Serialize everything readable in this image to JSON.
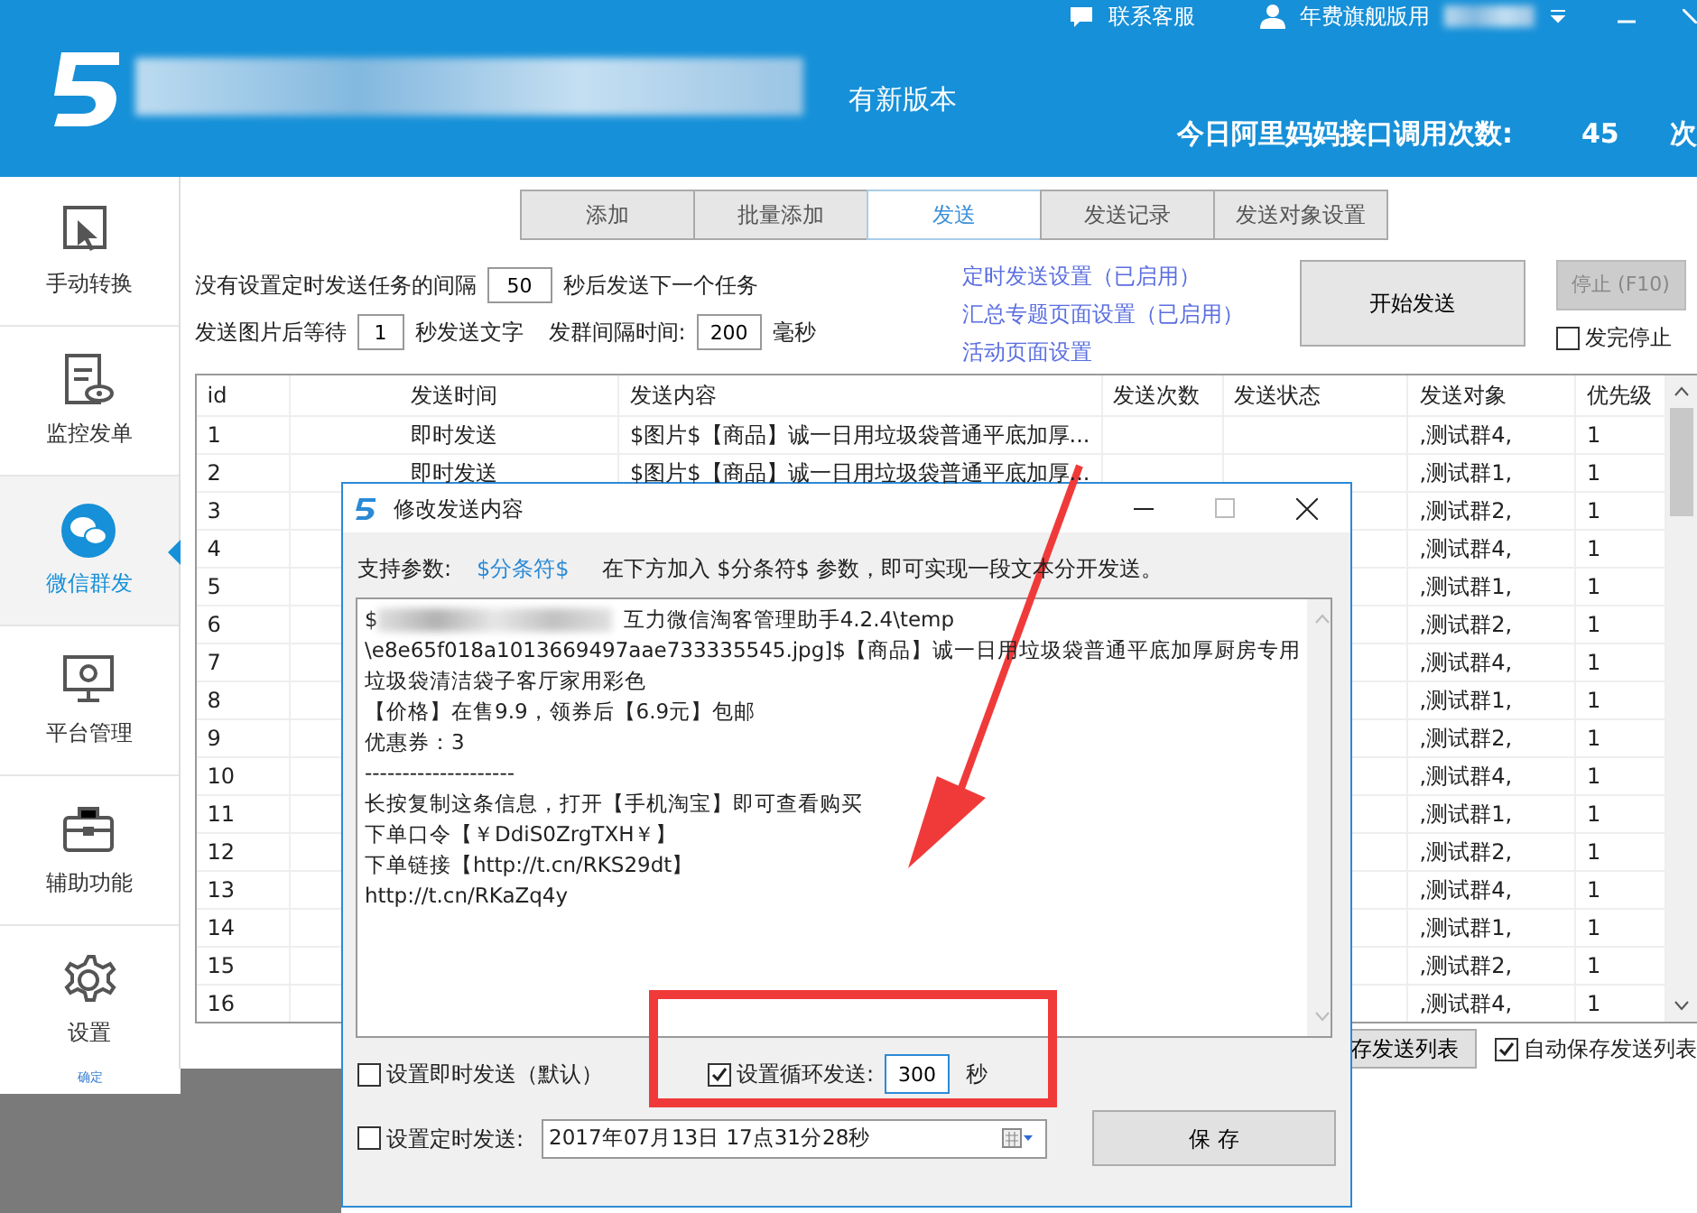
{
  "header": {
    "update_notice": "有新版本",
    "api_label": "今日阿里妈妈接口调用次数:",
    "api_count": "45",
    "api_suffix": "次",
    "top_links": [
      "联系客服",
      "年费旗舰版用"
    ]
  },
  "sidebar": {
    "items": [
      {
        "label": "手动转换",
        "selected": false
      },
      {
        "label": "监控发单",
        "selected": false
      },
      {
        "label": "微信群发",
        "selected": true
      },
      {
        "label": "平台管理",
        "selected": false
      },
      {
        "label": "辅助功能",
        "selected": false
      },
      {
        "label": "设置",
        "selected": false
      }
    ]
  },
  "tabs": [
    {
      "label": "添加",
      "selected": false
    },
    {
      "label": "批量添加",
      "selected": false
    },
    {
      "label": "发送",
      "selected": true
    },
    {
      "label": "发送记录",
      "selected": false
    },
    {
      "label": "发送对象设置",
      "selected": false
    }
  ],
  "settings": {
    "interval_prefix": "没有设置定时发送任务的间隔",
    "interval_value": "50",
    "interval_suffix": "秒后发送下一个任务",
    "wait_prefix": "发送图片后等待",
    "wait_value": "1",
    "wait_suffix": "秒发送文字",
    "group_label": "发群间隔时间:",
    "group_value": "200",
    "group_suffix": "毫秒",
    "links": [
      "定时发送设置（已启用）",
      "汇总专题页面设置（已启用）",
      "活动页面设置"
    ],
    "start_button": "开始发送",
    "stop_button": {
      "label": "停止 (F10)",
      "disabled": true
    },
    "stop_after": {
      "label": "发完停止",
      "checked": false
    }
  },
  "table": {
    "columns": [
      "id",
      "发送时间",
      "发送内容",
      "发送次数",
      "发送状态",
      "发送对象",
      "优先级"
    ],
    "rows": [
      {
        "id": "1",
        "time": "即时发送",
        "content": "$图片$【商品】诚一日用垃圾袋普通平底加厚...",
        "target": ",测试群4,",
        "priority": "1"
      },
      {
        "id": "2",
        "time": "即时发送",
        "content": "$图片$【商品】诚一日用垃圾袋普通平底加厚...",
        "target": ",测试群1,",
        "priority": "1"
      },
      {
        "id": "3",
        "target": ",测试群2,",
        "priority": "1"
      },
      {
        "id": "4",
        "target": ",测试群4,",
        "priority": "1"
      },
      {
        "id": "5",
        "target": ",测试群1,",
        "priority": "1"
      },
      {
        "id": "6",
        "target": ",测试群2,",
        "priority": "1"
      },
      {
        "id": "7",
        "target": ",测试群4,",
        "priority": "1"
      },
      {
        "id": "8",
        "target": ",测试群1,",
        "priority": "1"
      },
      {
        "id": "9",
        "target": ",测试群2,",
        "priority": "1"
      },
      {
        "id": "10",
        "target": ",测试群4,",
        "priority": "1"
      },
      {
        "id": "11",
        "target": ",测试群1,",
        "priority": "1"
      },
      {
        "id": "12",
        "target": ",测试群2,",
        "priority": "1"
      },
      {
        "id": "13",
        "target": ",测试群4,",
        "priority": "1"
      },
      {
        "id": "14",
        "target": ",测试群1,",
        "priority": "1"
      },
      {
        "id": "15",
        "target": ",测试群2,",
        "priority": "1"
      },
      {
        "id": "16",
        "target": ",测试群4,",
        "priority": "1"
      }
    ]
  },
  "below_table": {
    "save_list_button": "存发送列表",
    "auto_save": {
      "label": "自动保存发送列表",
      "checked": true
    }
  },
  "background_window": {
    "button": "确定"
  },
  "dialog": {
    "title": "修改发送内容",
    "params_label": "支持参数:",
    "param_token": "$分条符$",
    "param_hint": "在下方加入 $分条符$ 参数，即可实现一段文本分开发送。",
    "first_line": {
      "prefix": "$",
      "rest": "互力微信淘客管理助手4.2.4\\temp"
    },
    "lines": [
      "\\e8e65f018a1013669497aae733335545.jpg]$【商品】诚一日用垃圾袋普通平底加厚厨房专用",
      "垃圾袋清洁袋子客厅家用彩色",
      "【价格】在售9.9，领券后【6.9元】包邮",
      "优惠券：3",
      "--------------------",
      "长按复制这条信息，打开【手机淘宝】即可查看购买",
      "下单口令【￥DdiS0ZrgTXH￥】",
      "下单链接【http://t.cn/RKS29dt】",
      "http://t.cn/RKaZq4y"
    ],
    "immediate": {
      "label": "设置即时发送（默认）",
      "checked": false
    },
    "loop": {
      "label": "设置循环发送:",
      "checked": true,
      "value": "300",
      "unit": "秒"
    },
    "scheduled": {
      "label": "设置定时发送:",
      "checked": false,
      "value": "2017年07月13日 17点31分28秒"
    },
    "save_button": "保 存"
  }
}
